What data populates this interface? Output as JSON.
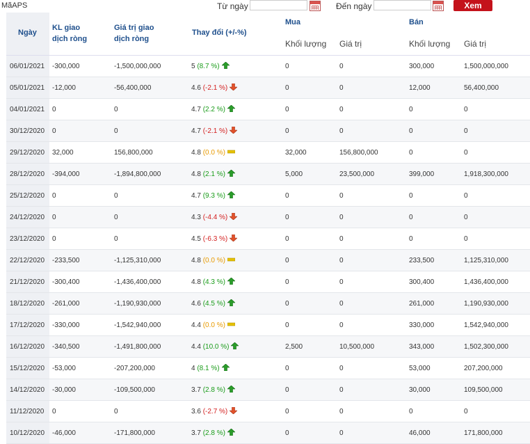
{
  "filter": {
    "code_label": "MãAPS",
    "from_label": "Từ ngày",
    "to_label": "Đến ngày",
    "from_value": "",
    "to_value": "",
    "submit_label": "Xem"
  },
  "headers": {
    "date": "Ngày",
    "kl_line1": "KL giao",
    "kl_line2": "dịch ròng",
    "gt_line1": "Giá trị giao",
    "gt_line2": "dịch ròng",
    "change": "Thay đổi (+/-%)",
    "buy": "Mua",
    "sell": "Bán",
    "buy_volume": "Khối lượng",
    "buy_value": "Giá trị",
    "sell_volume": "Khối lượng",
    "sell_value": "Giá trị"
  },
  "colors": {
    "up": "#1a9c1a",
    "down": "#d42020",
    "flat": "#e89a00",
    "header": "#1e4f8c"
  },
  "rows": [
    {
      "date": "06/01/2021",
      "kl": "-300,000",
      "gt": "-1,500,000,000",
      "price": "5",
      "pct": "(8.7 %)",
      "dir": "up",
      "mkl": "0",
      "mgt": "0",
      "bkl": "300,000",
      "bgt": "1,500,000,000"
    },
    {
      "date": "05/01/2021",
      "kl": "-12,000",
      "gt": "-56,400,000",
      "price": "4.6",
      "pct": "(-2.1 %)",
      "dir": "down",
      "mkl": "0",
      "mgt": "0",
      "bkl": "12,000",
      "bgt": "56,400,000"
    },
    {
      "date": "04/01/2021",
      "kl": "0",
      "gt": "0",
      "price": "4.7",
      "pct": "(2.2 %)",
      "dir": "up",
      "mkl": "0",
      "mgt": "0",
      "bkl": "0",
      "bgt": "0"
    },
    {
      "date": "30/12/2020",
      "kl": "0",
      "gt": "0",
      "price": "4.7",
      "pct": "(-2.1 %)",
      "dir": "down",
      "mkl": "0",
      "mgt": "0",
      "bkl": "0",
      "bgt": "0"
    },
    {
      "date": "29/12/2020",
      "kl": "32,000",
      "gt": "156,800,000",
      "price": "4.8",
      "pct": "(0.0 %)",
      "dir": "flat",
      "mkl": "32,000",
      "mgt": "156,800,000",
      "bkl": "0",
      "bgt": "0"
    },
    {
      "date": "28/12/2020",
      "kl": "-394,000",
      "gt": "-1,894,800,000",
      "price": "4.8",
      "pct": "(2.1 %)",
      "dir": "up",
      "mkl": "5,000",
      "mgt": "23,500,000",
      "bkl": "399,000",
      "bgt": "1,918,300,000"
    },
    {
      "date": "25/12/2020",
      "kl": "0",
      "gt": "0",
      "price": "4.7",
      "pct": "(9.3 %)",
      "dir": "up",
      "mkl": "0",
      "mgt": "0",
      "bkl": "0",
      "bgt": "0"
    },
    {
      "date": "24/12/2020",
      "kl": "0",
      "gt": "0",
      "price": "4.3",
      "pct": "(-4.4 %)",
      "dir": "down",
      "mkl": "0",
      "mgt": "0",
      "bkl": "0",
      "bgt": "0"
    },
    {
      "date": "23/12/2020",
      "kl": "0",
      "gt": "0",
      "price": "4.5",
      "pct": "(-6.3 %)",
      "dir": "down",
      "mkl": "0",
      "mgt": "0",
      "bkl": "0",
      "bgt": "0"
    },
    {
      "date": "22/12/2020",
      "kl": "-233,500",
      "gt": "-1,125,310,000",
      "price": "4.8",
      "pct": "(0.0 %)",
      "dir": "flat",
      "mkl": "0",
      "mgt": "0",
      "bkl": "233,500",
      "bgt": "1,125,310,000"
    },
    {
      "date": "21/12/2020",
      "kl": "-300,400",
      "gt": "-1,436,400,000",
      "price": "4.8",
      "pct": "(4.3 %)",
      "dir": "up",
      "mkl": "0",
      "mgt": "0",
      "bkl": "300,400",
      "bgt": "1,436,400,000"
    },
    {
      "date": "18/12/2020",
      "kl": "-261,000",
      "gt": "-1,190,930,000",
      "price": "4.6",
      "pct": "(4.5 %)",
      "dir": "up",
      "mkl": "0",
      "mgt": "0",
      "bkl": "261,000",
      "bgt": "1,190,930,000"
    },
    {
      "date": "17/12/2020",
      "kl": "-330,000",
      "gt": "-1,542,940,000",
      "price": "4.4",
      "pct": "(0.0 %)",
      "dir": "flat",
      "mkl": "0",
      "mgt": "0",
      "bkl": "330,000",
      "bgt": "1,542,940,000"
    },
    {
      "date": "16/12/2020",
      "kl": "-340,500",
      "gt": "-1,491,800,000",
      "price": "4.4",
      "pct": "(10.0 %)",
      "dir": "up",
      "mkl": "2,500",
      "mgt": "10,500,000",
      "bkl": "343,000",
      "bgt": "1,502,300,000"
    },
    {
      "date": "15/12/2020",
      "kl": "-53,000",
      "gt": "-207,200,000",
      "price": "4",
      "pct": "(8.1 %)",
      "dir": "up",
      "mkl": "0",
      "mgt": "0",
      "bkl": "53,000",
      "bgt": "207,200,000"
    },
    {
      "date": "14/12/2020",
      "kl": "-30,000",
      "gt": "-109,500,000",
      "price": "3.7",
      "pct": "(2.8 %)",
      "dir": "up",
      "mkl": "0",
      "mgt": "0",
      "bkl": "30,000",
      "bgt": "109,500,000"
    },
    {
      "date": "11/12/2020",
      "kl": "0",
      "gt": "0",
      "price": "3.6",
      "pct": "(-2.7 %)",
      "dir": "down",
      "mkl": "0",
      "mgt": "0",
      "bkl": "0",
      "bgt": "0"
    },
    {
      "date": "10/12/2020",
      "kl": "-46,000",
      "gt": "-171,800,000",
      "price": "3.7",
      "pct": "(2.8 %)",
      "dir": "up",
      "mkl": "0",
      "mgt": "0",
      "bkl": "46,000",
      "bgt": "171,800,000"
    }
  ]
}
